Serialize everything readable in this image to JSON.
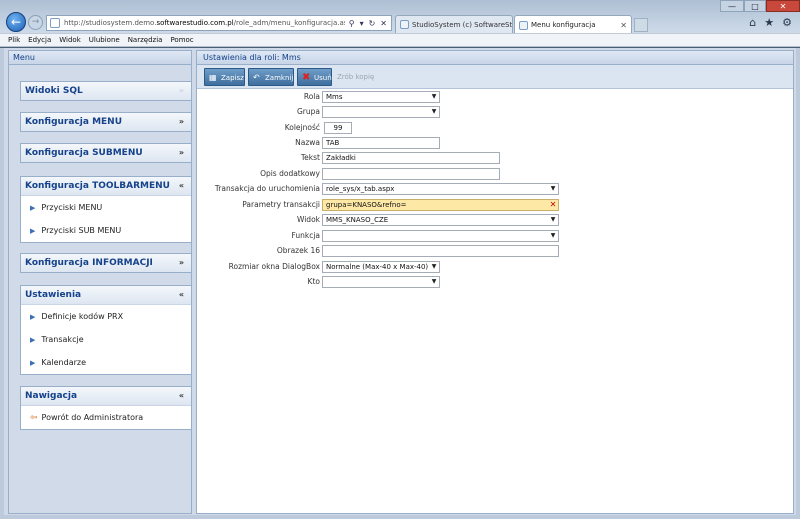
{
  "browser": {
    "url_prefix": "http://studiosystem.demo.",
    "url_domain": "softwarestudio.com.pl",
    "url_rest": "/role_adm/menu_konfiguracja.aspx?rola=M",
    "tabs": [
      {
        "label": "StudioSystem (c) SoftwareStud..."
      },
      {
        "label": "Menu konfiguracja"
      }
    ],
    "menubar": [
      "Plik",
      "Edycja",
      "Widok",
      "Ulubione",
      "Narzędzia",
      "Pomoc"
    ]
  },
  "left": {
    "header": "Menu",
    "sections": [
      {
        "title": "Widoki SQL",
        "toggle": "»",
        "items": []
      },
      {
        "title": "Konfiguracja MENU",
        "toggle": "»",
        "items": []
      },
      {
        "title": "Konfiguracja SUBMENU",
        "toggle": "»",
        "items": []
      },
      {
        "title": "Konfiguracja TOOLBARMENU",
        "toggle": "«",
        "items": [
          "Przyciski MENU",
          "Przyciski SUB MENU"
        ]
      },
      {
        "title": "Konfiguracja INFORMACJI",
        "toggle": "»",
        "items": []
      },
      {
        "title": "Ustawienia",
        "toggle": "«",
        "items": [
          "Definicje kodów PRX",
          "Transakcje",
          "Kalendarze"
        ]
      },
      {
        "title": "Nawigacja",
        "toggle": "«",
        "items": [
          "Powrót do Administratora"
        ]
      }
    ]
  },
  "main": {
    "header": "Ustawienia dla roli: Mms",
    "toolbar": {
      "save": "Zapisz",
      "close": "Zamknij",
      "delete": "Usuń",
      "copy": "Zrób kopię"
    },
    "form": {
      "rola": {
        "label": "Rola",
        "value": "Mms"
      },
      "grupa": {
        "label": "Grupa",
        "value": ""
      },
      "kolejnosc": {
        "label": "Kolejność",
        "value": "99"
      },
      "nazwa": {
        "label": "Nazwa",
        "value": "TAB"
      },
      "tekst": {
        "label": "Tekst",
        "value": "Zakładki"
      },
      "opis": {
        "label": "Opis dodatkowy",
        "value": ""
      },
      "transakcja": {
        "label": "Transakcja do uruchomienia",
        "value": "role_sys/x_tab.aspx"
      },
      "parametry": {
        "label": "Parametry transakcji",
        "value": "grupa=KNASO&refno="
      },
      "widok": {
        "label": "Widok",
        "value": "MMS_KNASO_CZE"
      },
      "funkcja": {
        "label": "Funkcja",
        "value": ""
      },
      "obrazek": {
        "label": "Obrazek 16",
        "value": ""
      },
      "rozmiar": {
        "label": "Rozmiar okna DialogBox",
        "value": "Normalne (Max-40 x Max-40)"
      },
      "kto": {
        "label": "Kto",
        "value": ""
      }
    }
  }
}
